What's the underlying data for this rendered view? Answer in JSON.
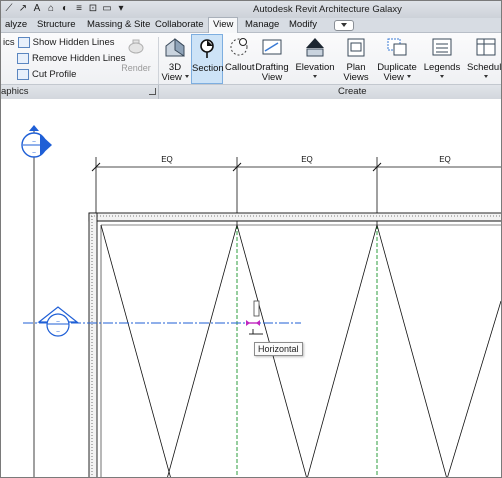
{
  "window": {
    "title": "Autodesk Revit Architecture Galaxy"
  },
  "tabs": [
    {
      "label": "alyze"
    },
    {
      "label": "Structure"
    },
    {
      "label": "Massing & Site"
    },
    {
      "label": "Collaborate"
    },
    {
      "label": "View",
      "active": true
    },
    {
      "label": "Manage"
    },
    {
      "label": "Modify"
    }
  ],
  "graphics_panel": {
    "label": "aphics",
    "items": [
      {
        "prefix": "ics",
        "label": "Show Hidden Lines"
      },
      {
        "label": "Remove Hidden Lines"
      },
      {
        "label": "Cut Profile"
      }
    ],
    "render_label": "Render"
  },
  "create_panel": {
    "label": "Create",
    "buttons": [
      {
        "line1": "3D",
        "line2": "View",
        "icon": "house-3d-icon"
      },
      {
        "line1": "Section",
        "line2": "",
        "icon": "section-icon"
      },
      {
        "line1": "Callout",
        "line2": "",
        "icon": "callout-icon"
      },
      {
        "line1": "Drafting",
        "line2": "View",
        "icon": "drafting-view-icon"
      },
      {
        "line1": "Elevation",
        "line2": "",
        "icon": "elevation-icon"
      },
      {
        "line1": "Plan",
        "line2": "Views",
        "icon": "plan-views-icon"
      },
      {
        "line1": "Duplicate",
        "line2": "View",
        "icon": "duplicate-view-icon"
      },
      {
        "line1": "Legends",
        "line2": "",
        "icon": "legends-icon"
      },
      {
        "line1": "Schedule",
        "line2": "",
        "icon": "schedule-icon"
      }
    ]
  },
  "drawing": {
    "dimension_labels": [
      "EQ",
      "EQ",
      "EQ"
    ],
    "tooltip": "Horizontal"
  },
  "colors": {
    "section_blue": "#1f5fd6",
    "active_button": "#cde3f7",
    "ribbon_bg": "#f3f4f6"
  }
}
